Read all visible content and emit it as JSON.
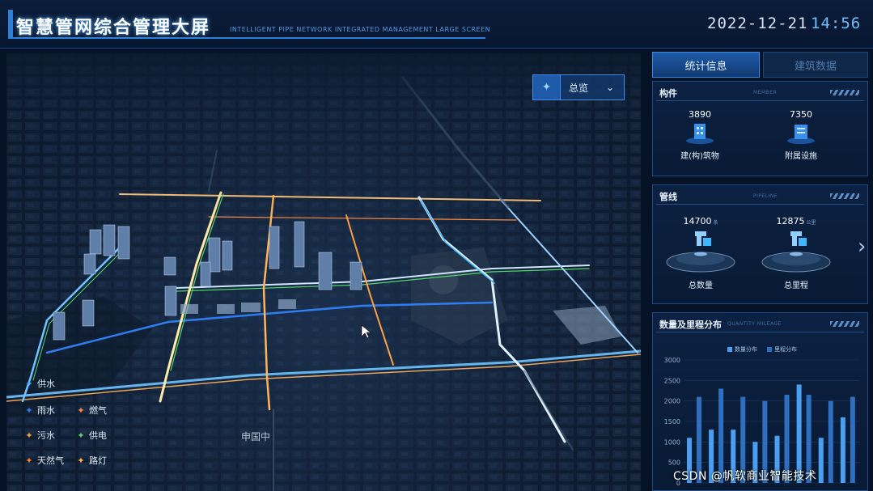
{
  "header": {
    "title": "智慧管网综合管理大屏",
    "subtitle": "INTELLIGENT PIPE NETWORK INTEGRATED MANAGEMENT LARGE SCREEN",
    "date": "2022-12-21",
    "time": "14:56"
  },
  "map": {
    "dropdown": {
      "label": "总览",
      "icon": "location-pin-icon"
    },
    "district_labels": [
      "申国中"
    ],
    "legend": [
      {
        "label": "供水",
        "color": "#3fb6ff",
        "icon": "diamond-icon"
      },
      {
        "label": "雨水",
        "color": "#2f7df2",
        "icon": "diamond-icon"
      },
      {
        "label": "燃气",
        "color": "#ff8a3d",
        "icon": "diamond-icon"
      },
      {
        "label": "污水",
        "color": "#f2a23d",
        "icon": "diamond-icon"
      },
      {
        "label": "供电",
        "color": "#57d66b",
        "icon": "diamond-icon"
      },
      {
        "label": "天然气",
        "color": "#ff7a2e",
        "icon": "diamond-icon"
      },
      {
        "label": "路灯",
        "color": "#ffb84a",
        "icon": "diamond-icon"
      }
    ]
  },
  "panel": {
    "tabs": [
      {
        "label": "统计信息",
        "active": true
      },
      {
        "label": "建筑数据",
        "active": false
      }
    ],
    "components": {
      "title": "构件",
      "title_en": "MEMBER",
      "items": [
        {
          "value": "3890",
          "label": "建(构)筑物",
          "icon": "building-icon"
        },
        {
          "value": "7350",
          "label": "附属设施",
          "icon": "facility-icon"
        }
      ]
    },
    "pipelines": {
      "title": "管线",
      "title_en": "PIPELINE",
      "items": [
        {
          "value": "14700",
          "unit": "条",
          "label": "总数量",
          "icon": "pipe-icon"
        },
        {
          "value": "12875",
          "unit": "公里",
          "label": "总里程",
          "icon": "pipe-icon"
        }
      ]
    },
    "distribution": {
      "title": "数量及里程分布",
      "title_en": "QUANTITY MILEAGE"
    }
  },
  "chart_data": {
    "type": "bar",
    "series": [
      {
        "name": "数量分布",
        "color": "#4a9ff0",
        "values": [
          1100,
          1300,
          1300,
          1000,
          1150,
          2400,
          1100,
          1600
        ]
      },
      {
        "name": "里程分布",
        "color": "#2f6fbf",
        "values": [
          2100,
          2300,
          2100,
          2000,
          2150,
          2150,
          2000,
          2100
        ]
      }
    ],
    "ylim": [
      0,
      3000
    ],
    "yticks": [
      "3000",
      "2500",
      "2000",
      "1500",
      "1000",
      "500",
      "0"
    ],
    "legend_position": "top"
  },
  "navigation": {
    "next_icon": "chevron-right-icon"
  },
  "watermark": "CSDN @帆软商业智能技术"
}
